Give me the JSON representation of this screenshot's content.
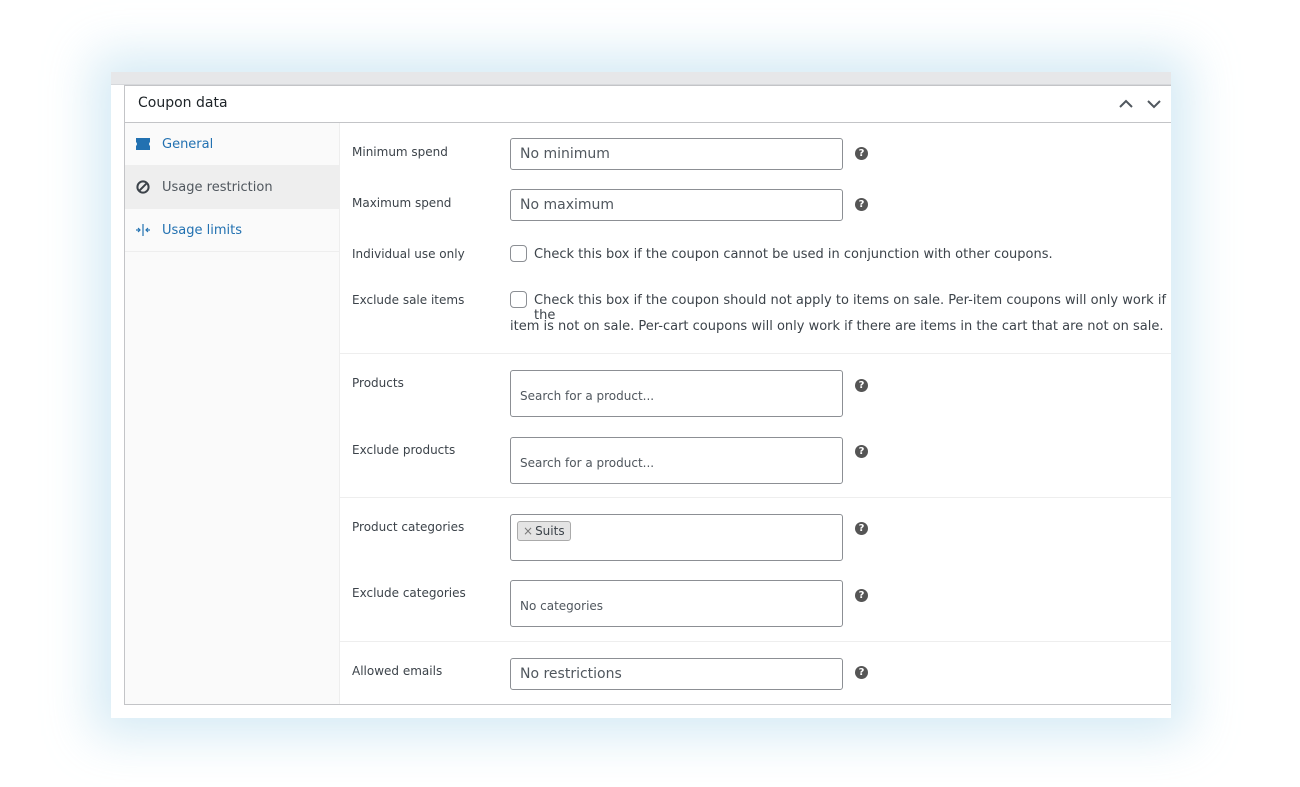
{
  "panel": {
    "title": "Coupon data",
    "controls": [
      "chevron-up-icon",
      "chevron-down-icon"
    ]
  },
  "tabs": [
    {
      "label": "General",
      "icon": "ticket-icon",
      "active": false
    },
    {
      "label": "Usage restriction",
      "icon": "no-entry-icon",
      "active": true
    },
    {
      "label": "Usage limits",
      "icon": "arrows-icon",
      "active": false
    }
  ],
  "fields": {
    "minimum_spend": {
      "label": "Minimum spend",
      "placeholder": "No minimum",
      "help": "?"
    },
    "maximum_spend": {
      "label": "Maximum spend",
      "placeholder": "No maximum",
      "help": "?"
    },
    "individual_use": {
      "label": "Individual use only",
      "description": "Check this box if the coupon cannot be used in conjunction with other coupons.",
      "checked": false
    },
    "exclude_sale": {
      "label": "Exclude sale items",
      "description_line1": "Check this box if the coupon should not apply to items on sale. Per-item coupons will only work if the",
      "description_line2": "item is not on sale. Per-cart coupons will only work if there are items in the cart that are not on sale.",
      "checked": false
    },
    "products": {
      "label": "Products",
      "placeholder": "Search for a product...",
      "help": "?"
    },
    "exclude_products": {
      "label": "Exclude products",
      "placeholder": "Search for a product...",
      "help": "?"
    },
    "product_categories": {
      "label": "Product categories",
      "selected": [
        "Suits"
      ],
      "remove_symbol": "×",
      "help": "?"
    },
    "exclude_categories": {
      "label": "Exclude categories",
      "placeholder": "No categories",
      "help": "?"
    },
    "allowed_emails": {
      "label": "Allowed emails",
      "placeholder": "No restrictions",
      "help": "?"
    }
  },
  "colors": {
    "link": "#2271b1",
    "text": "#3c434a",
    "border": "#8c8f94",
    "help_icon": "#555555",
    "active_tab_bg": "#eeeeee"
  }
}
